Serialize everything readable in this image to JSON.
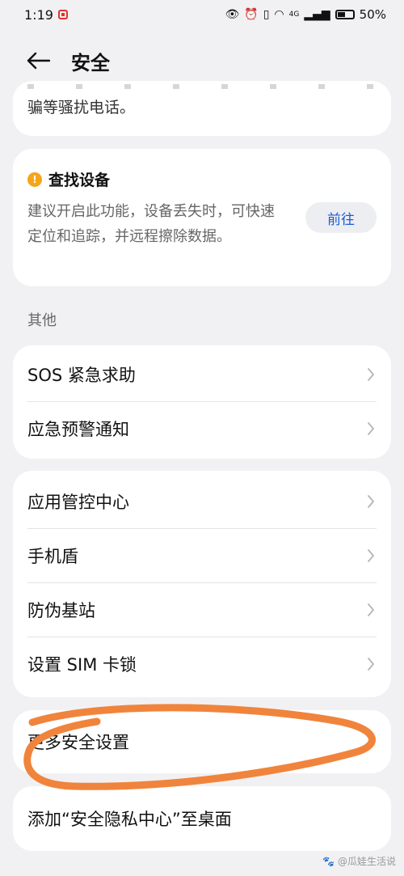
{
  "status_bar": {
    "time": "1:19",
    "battery_percent": "50%",
    "battery_level": 0.5,
    "network": "4G"
  },
  "header": {
    "title": "安全"
  },
  "partial_card": {
    "text": "骗等骚扰电话。"
  },
  "find_device": {
    "title": "查找设备",
    "description": "建议开启此功能，设备丢失时，可快速定位和追踪，并远程擦除数据。",
    "button": "前往"
  },
  "section_other": "其他",
  "other_items": [
    "SOS 紧急求助",
    "应急预警通知"
  ],
  "tools_items": [
    "应用管控中心",
    "手机盾",
    "防伪基站",
    "设置 SIM 卡锁"
  ],
  "more_security": "更多安全设置",
  "add_to_desktop": "添加“安全隐私中心”至桌面",
  "watermark": "@瓜娃生活说",
  "colors": {
    "accent": "#1d5ad6",
    "warning": "#f3a51b",
    "annotation": "#f0843c"
  }
}
